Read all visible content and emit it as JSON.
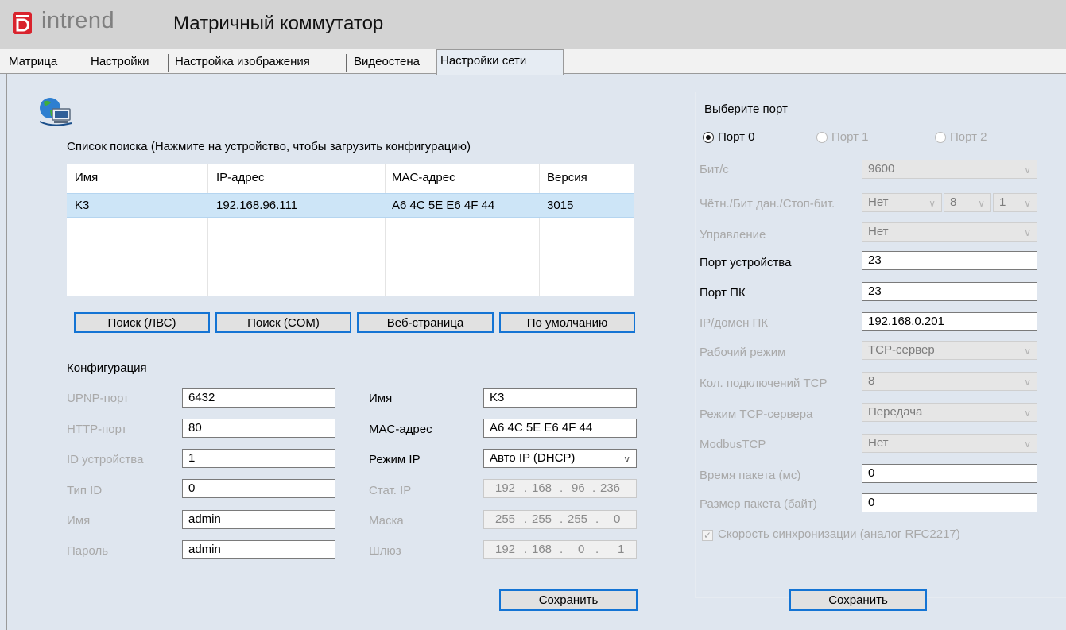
{
  "app": {
    "brand": "intrend",
    "title": "Матричный коммутатор",
    "accent_color": "#d9232d"
  },
  "tabs": [
    "Матрица",
    "Настройки",
    "Настройка изображения",
    "Видеостена",
    "Настройки сети"
  ],
  "active_tab": "Настройки сети",
  "search": {
    "caption": "Список поиска (Нажмите на устройство, чтобы загрузить конфигурацию)",
    "columns": [
      "Имя",
      "IP-адрес",
      "MAC-адрес",
      "Версия"
    ],
    "rows": [
      {
        "name": "K3",
        "ip": "192.168.96.111",
        "mac": "A6 4C 5E E6 4F 44",
        "version": "3015"
      }
    ],
    "buttons": {
      "lan": "Поиск (ЛВС)",
      "com": "Поиск (COM)",
      "web": "Веб-страница",
      "default": "По умолчанию"
    }
  },
  "config": {
    "title": "Конфигурация",
    "upnp_label": "UPNP-порт",
    "upnp_value": "6432",
    "http_label": "HTTP-порт",
    "http_value": "80",
    "devid_label": "ID устройства",
    "devid_value": "1",
    "typeid_label": "Тип ID",
    "typeid_value": "0",
    "user_label": "Имя",
    "user_value": "admin",
    "password_label": "Пароль",
    "password_value": "admin",
    "name_label": "Имя",
    "name_value": "K3",
    "mac_label": "MAC-адрес",
    "mac_value": "A6 4C 5E E6 4F 44",
    "ipmode_label": "Режим IP",
    "ipmode_value": "Авто IP (DHCP)",
    "static_ip_label": "Стат. IP",
    "static_ip": [
      "192",
      "168",
      "96",
      "236"
    ],
    "mask_label": "Маска",
    "mask": [
      "255",
      "255",
      "255",
      "0"
    ],
    "gateway_label": "Шлюз",
    "gateway": [
      "192",
      "168",
      "0",
      "1"
    ],
    "save": "Сохранить"
  },
  "port": {
    "title": "Выберите порт",
    "options": [
      "Порт 0",
      "Порт 1",
      "Порт 2"
    ],
    "selected": "Порт 0",
    "baud_label": "Бит/с",
    "baud_value": "9600",
    "parity_label": "Чётн./Бит дан./Стоп-бит.",
    "parity_value": "Нет",
    "databits_value": "8",
    "stopbits_value": "1",
    "flow_label": "Управление",
    "flow_value": "Нет",
    "device_port_label": "Порт устройства",
    "device_port_value": "23",
    "pc_port_label": "Порт ПК",
    "pc_port_value": "23",
    "pc_ip_label": "IP/домен ПК",
    "pc_ip_value": "192.168.0.201",
    "work_mode_label": "Рабочий режим",
    "work_mode_value": "TCP-сервер",
    "tcp_conn_label": "Кол. подключений TCP",
    "tcp_conn_value": "8",
    "tcp_server_mode_label": "Режим TCP-сервера",
    "tcp_server_mode_value": "Передача",
    "modbus_label": "ModbusTCP",
    "modbus_value": "Нет",
    "packet_time_label": "Время пакета (мс)",
    "packet_time_value": "0",
    "packet_size_label": "Размер пакета (байт)",
    "packet_size_value": "0",
    "sync_label": "Скорость синхронизации (аналог RFC2217)",
    "sync_checked": true,
    "save": "Сохранить"
  }
}
